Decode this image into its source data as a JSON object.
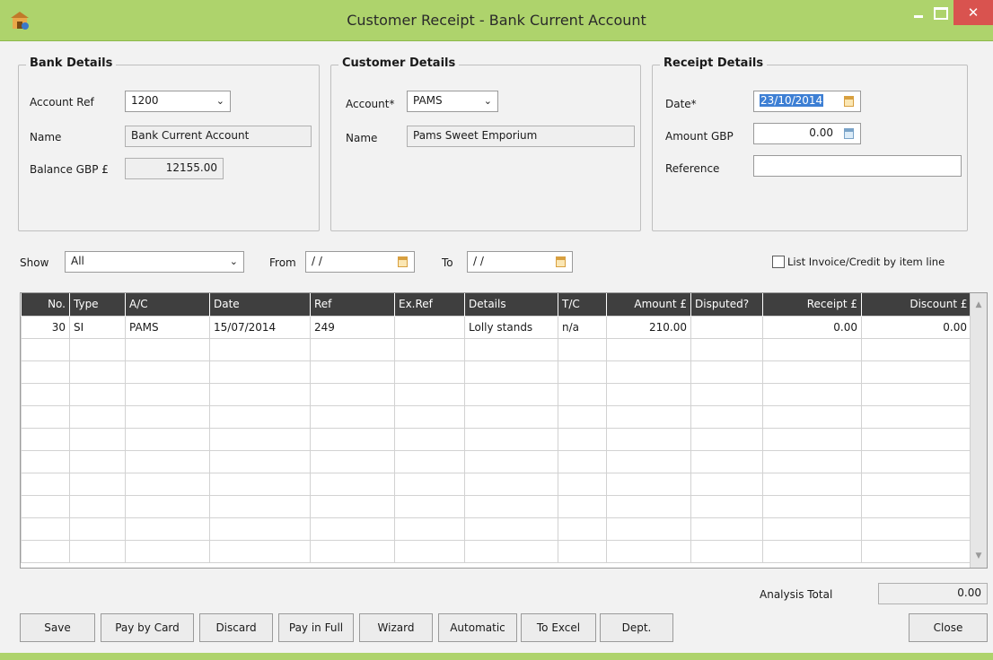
{
  "window": {
    "title": "Customer Receipt - Bank Current Account",
    "close_glyph": "✕"
  },
  "bank_details": {
    "title": "Bank Details",
    "account_ref_label": "Account Ref",
    "account_ref_value": "1200",
    "name_label": "Name",
    "name_value": "Bank Current Account",
    "balance_label": "Balance GBP £",
    "balance_value": "12155.00"
  },
  "customer_details": {
    "title": "Customer Details",
    "account_label": "Account*",
    "account_value": "PAMS",
    "name_label": "Name",
    "name_value": "Pams Sweet Emporium"
  },
  "receipt_details": {
    "title": "Receipt Details",
    "date_label": "Date*",
    "date_value": "23/10/2014",
    "amount_label": "Amount GBP",
    "amount_value": "0.00",
    "reference_label": "Reference",
    "reference_value": ""
  },
  "filter": {
    "show_label": "Show",
    "show_value": "All",
    "from_label": "From",
    "from_value": "/ /",
    "to_label": "To",
    "to_value": "/ /",
    "list_by_item_label": "List Invoice/Credit by item line",
    "list_by_item_checked": false
  },
  "grid": {
    "columns": [
      "No.",
      "Type",
      "A/C",
      "Date",
      "Ref",
      "Ex.Ref",
      "Details",
      "T/C",
      "Amount £",
      "Disputed?",
      "Receipt £",
      "Discount £"
    ],
    "rows": [
      [
        "30",
        "SI",
        "PAMS",
        "15/07/2014",
        "249",
        "",
        "Lolly stands",
        "n/a",
        "210.00",
        "",
        "0.00",
        "0.00"
      ]
    ]
  },
  "analysis": {
    "label": "Analysis Total",
    "value": "0.00"
  },
  "buttons": {
    "save": "Save",
    "pay_by_card": "Pay by Card",
    "discard": "Discard",
    "pay_in_full": "Pay in Full",
    "wizard": "Wizard",
    "automatic": "Automatic",
    "to_excel": "To Excel",
    "dept": "Dept.",
    "close": "Close"
  },
  "colors": {
    "titlebar": "#aed36c",
    "close_button": "#d9534f",
    "grid_header": "#3f3f3f",
    "selection": "#3d7fd4"
  }
}
